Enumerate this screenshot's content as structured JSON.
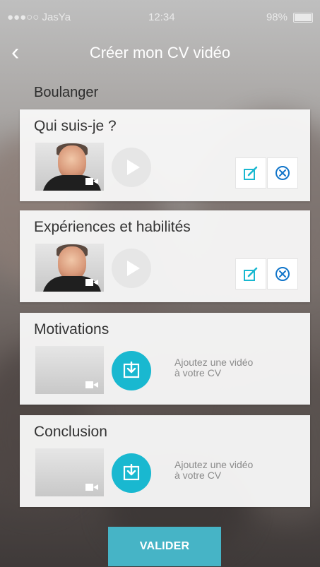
{
  "status": {
    "carrier": "●●●○○ JasYa",
    "time": "12:34",
    "battery": "98%"
  },
  "header": {
    "title": "Créer mon CV vidéo"
  },
  "section": {
    "title": "Boulanger"
  },
  "cards": [
    {
      "title": "Qui suis-je ?",
      "state": "recorded"
    },
    {
      "title": "Expériences et habilités",
      "state": "recorded"
    },
    {
      "title": "Motivations",
      "state": "empty",
      "hint_line1": "Ajoutez une vidéo",
      "hint_line2": "à votre CV"
    },
    {
      "title": "Conclusion",
      "state": "empty",
      "hint_line1": "Ajoutez une vidéo",
      "hint_line2": "à votre CV"
    }
  ],
  "footer": {
    "validate_label": "VALIDER"
  },
  "colors": {
    "accent": "#19b8d0",
    "validate": "#46b4c6",
    "remove_icon": "#0f74c9"
  }
}
